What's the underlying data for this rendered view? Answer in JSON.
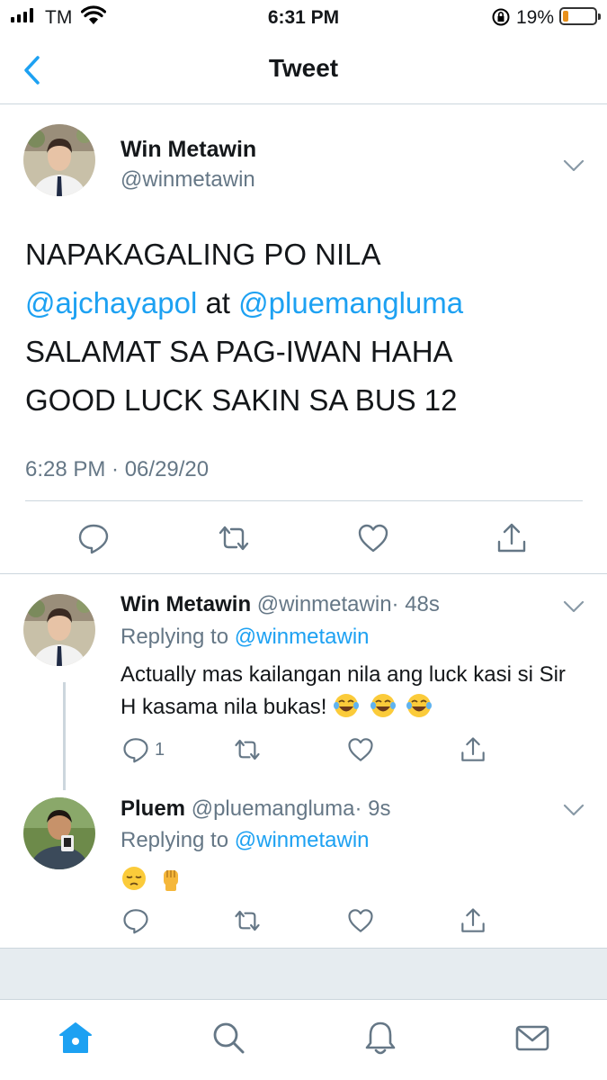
{
  "status_bar": {
    "carrier": "TM",
    "time": "6:31 PM",
    "battery_percent": "19%",
    "battery_level": 0.19,
    "icons": [
      "signal-icon",
      "wifi-icon",
      "orientation-lock-icon",
      "battery-icon"
    ]
  },
  "nav": {
    "title": "Tweet",
    "back_icon": "chevron-left-icon"
  },
  "main_tweet": {
    "author_name": "Win Metawin",
    "author_handle": "@winmetawin",
    "line1": "NAPAKAGALING PO NILA",
    "mention1": "@ajchayapol",
    "connector": " at ",
    "mention2": "@pluemangluma",
    "line3": "SALAMAT SA PAG-IWAN HAHA",
    "line4": "GOOD LUCK SAKIN SA BUS 12",
    "timestamp": "6:28 PM · 06/29/20",
    "actions": [
      "reply-icon",
      "retweet-icon",
      "like-icon",
      "share-icon"
    ]
  },
  "replies": [
    {
      "author_name": "Win Metawin",
      "author_handle": "@winmetawin",
      "age": "· 48s",
      "replying_prefix": "Replying to ",
      "replying_to": "@winmetawin",
      "text": "Actually mas kailangan nila ang luck kasi si Sir H kasama nila bukas!",
      "emoji": [
        "face-with-tears-of-joy",
        "face-with-tears-of-joy",
        "face-with-tears-of-joy"
      ],
      "reply_count": "1"
    },
    {
      "author_name": "Pluem",
      "author_handle": "@pluemangluma",
      "age": "· 9s",
      "replying_prefix": "Replying to ",
      "replying_to": "@winmetawin",
      "emoji": [
        "pensive-face",
        "raised-fist"
      ]
    }
  ],
  "tab_bar": {
    "tabs": [
      "home-icon",
      "search-icon",
      "notifications-icon",
      "messages-icon"
    ],
    "active": "home-icon"
  },
  "colors": {
    "link": "#1da1f2",
    "secondary_text": "#657786",
    "divider": "#ccd6dd",
    "background_gray": "#e6ecf0",
    "battery_low": "#e8901a"
  }
}
